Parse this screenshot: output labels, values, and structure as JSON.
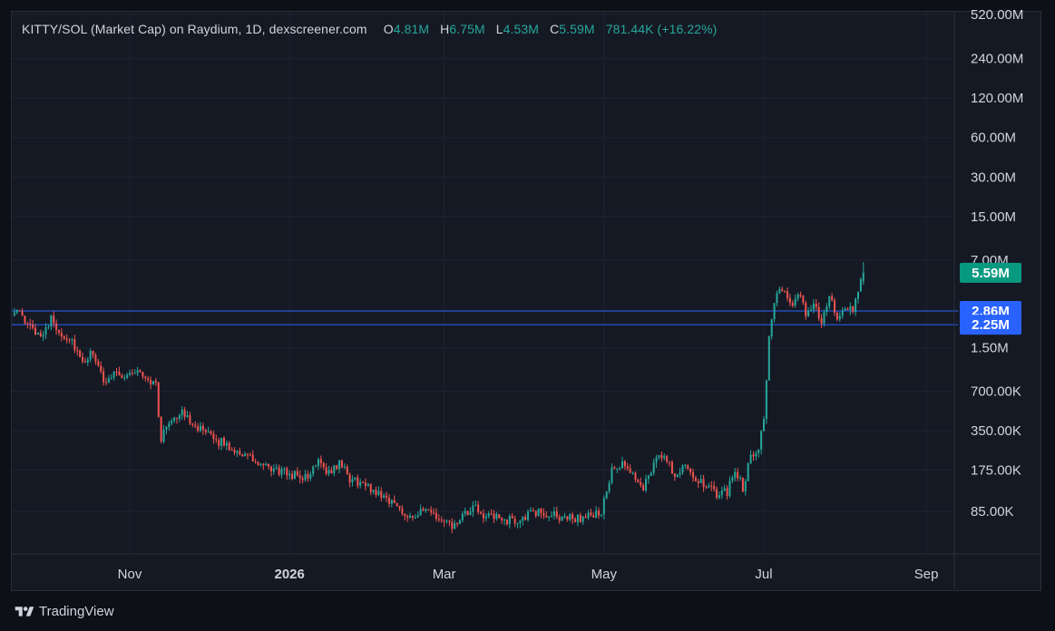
{
  "legend": {
    "title": "KITTY/SOL (Market Cap) on Raydium, 1D, dexscreener.com",
    "o_label": "O",
    "o_value": "4.81M",
    "h_label": "H",
    "h_value": "6.75M",
    "l_label": "L",
    "l_value": "4.53M",
    "c_label": "C",
    "c_value": "5.59M",
    "change": "781.44K (+16.22%)"
  },
  "footer": {
    "brand": "TradingView"
  },
  "colors": {
    "up": "#26a69a",
    "down": "#ef5350",
    "grid": "#1f2430",
    "hline": "#2962ff",
    "badge_last": "#089981",
    "badge_line": "#2962ff"
  },
  "chart_data": {
    "type": "candlestick",
    "scale": "log",
    "x_ticks": [
      {
        "label": "Nov",
        "day": 44
      },
      {
        "label": "2026",
        "day": 105,
        "bold": true
      },
      {
        "label": "Mar",
        "day": 164
      },
      {
        "label": "May",
        "day": 225
      },
      {
        "label": "Jul",
        "day": 286
      },
      {
        "label": "Sep",
        "day": 348
      }
    ],
    "y_ticks": [
      {
        "label": "520.00M",
        "value": 520000000
      },
      {
        "label": "240.00M",
        "value": 240000000
      },
      {
        "label": "120.00M",
        "value": 120000000
      },
      {
        "label": "60.00M",
        "value": 60000000
      },
      {
        "label": "30.00M",
        "value": 30000000
      },
      {
        "label": "15.00M",
        "value": 15000000
      },
      {
        "label": "7.00M",
        "value": 7000000
      },
      {
        "label": "1.50M",
        "value": 1500000
      },
      {
        "label": "700.00K",
        "value": 700000
      },
      {
        "label": "350.00K",
        "value": 350000
      },
      {
        "label": "175.00K",
        "value": 175000
      },
      {
        "label": "85.00K",
        "value": 85000
      }
    ],
    "horizontal_lines": [
      {
        "label": "2.86M",
        "value": 2860000
      },
      {
        "label": "2.25M",
        "value": 2250000
      }
    ],
    "last_price": {
      "label": "5.59M",
      "value": 5590000
    },
    "anchors": [
      [
        0,
        3000000
      ],
      [
        5,
        2200000
      ],
      [
        10,
        1900000
      ],
      [
        14,
        2450000
      ],
      [
        18,
        1900000
      ],
      [
        22,
        1700000
      ],
      [
        26,
        1100000
      ],
      [
        30,
        1400000
      ],
      [
        34,
        800000
      ],
      [
        38,
        1000000
      ],
      [
        42,
        900000
      ],
      [
        46,
        1000000
      ],
      [
        50,
        900000
      ],
      [
        54,
        780000
      ],
      [
        56,
        290000
      ],
      [
        58,
        380000
      ],
      [
        60,
        440000
      ],
      [
        64,
        470000
      ],
      [
        68,
        410000
      ],
      [
        72,
        340000
      ],
      [
        76,
        300000
      ],
      [
        80,
        280000
      ],
      [
        84,
        250000
      ],
      [
        88,
        230000
      ],
      [
        92,
        200000
      ],
      [
        96,
        180000
      ],
      [
        100,
        175000
      ],
      [
        104,
        165000
      ],
      [
        108,
        160000
      ],
      [
        112,
        150000
      ],
      [
        116,
        220000
      ],
      [
        120,
        165000
      ],
      [
        124,
        200000
      ],
      [
        128,
        150000
      ],
      [
        132,
        140000
      ],
      [
        136,
        125000
      ],
      [
        140,
        115000
      ],
      [
        144,
        100000
      ],
      [
        148,
        85000
      ],
      [
        152,
        78000
      ],
      [
        156,
        85000
      ],
      [
        160,
        80000
      ],
      [
        164,
        68000
      ],
      [
        168,
        65000
      ],
      [
        172,
        80000
      ],
      [
        176,
        90000
      ],
      [
        180,
        78000
      ],
      [
        184,
        75000
      ],
      [
        188,
        73000
      ],
      [
        192,
        72000
      ],
      [
        196,
        80000
      ],
      [
        200,
        83000
      ],
      [
        204,
        80000
      ],
      [
        208,
        77000
      ],
      [
        212,
        76000
      ],
      [
        216,
        75000
      ],
      [
        220,
        79000
      ],
      [
        224,
        85000
      ],
      [
        226,
        120000
      ],
      [
        228,
        170000
      ],
      [
        232,
        190000
      ],
      [
        236,
        160000
      ],
      [
        240,
        130000
      ],
      [
        244,
        200000
      ],
      [
        248,
        230000
      ],
      [
        252,
        160000
      ],
      [
        256,
        200000
      ],
      [
        260,
        150000
      ],
      [
        264,
        130000
      ],
      [
        268,
        115000
      ],
      [
        272,
        120000
      ],
      [
        275,
        180000
      ],
      [
        278,
        130000
      ],
      [
        281,
        220000
      ],
      [
        284,
        270000
      ],
      [
        286,
        450000
      ],
      [
        288,
        1800000
      ],
      [
        290,
        3400000
      ],
      [
        293,
        4200000
      ],
      [
        296,
        3100000
      ],
      [
        299,
        3900000
      ],
      [
        302,
        2700000
      ],
      [
        305,
        3300000
      ],
      [
        308,
        2400000
      ],
      [
        311,
        3600000
      ],
      [
        314,
        2500000
      ],
      [
        317,
        3000000
      ],
      [
        320,
        2800000
      ],
      [
        322,
        4200000
      ],
      [
        324,
        5590000
      ]
    ],
    "xlim_days": [
      -1,
      358
    ]
  }
}
